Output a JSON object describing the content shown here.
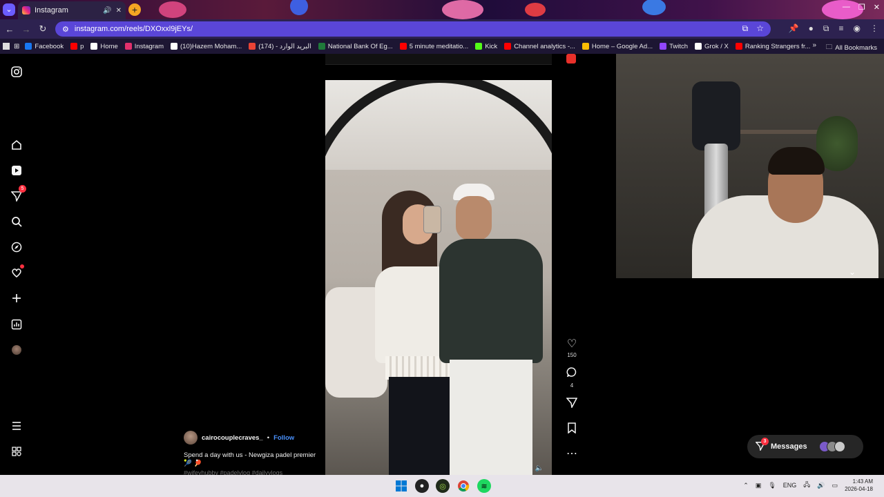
{
  "browser": {
    "tab_title": "Instagram",
    "url": "instagram.com/reels/DXOxxl9jEYs/",
    "bookmarks": [
      {
        "label": "Facebook",
        "color": "#1877f2"
      },
      {
        "label": "p",
        "color": "#ff0000"
      },
      {
        "label": "Home",
        "color": "#ffffff"
      },
      {
        "label": "Instagram",
        "color": "#e1306c"
      },
      {
        "label": "(10)Hazem Moham...",
        "color": "#ffffff"
      },
      {
        "label": "(174) - البريد الوارد",
        "color": "#ea4335"
      },
      {
        "label": "National Bank Of Eg...",
        "color": "#1f7a3a"
      },
      {
        "label": "5 minute meditatio...",
        "color": "#ff0000"
      },
      {
        "label": "Kick",
        "color": "#53fc18"
      },
      {
        "label": "Channel analytics -...",
        "color": "#ff0000"
      },
      {
        "label": "Home – Google Ad...",
        "color": "#fbbc04"
      },
      {
        "label": "Twitch",
        "color": "#9146ff"
      },
      {
        "label": "Grok / X",
        "color": "#ffffff"
      },
      {
        "label": "Ranking Strangers fr...",
        "color": "#ff0000"
      }
    ],
    "all_bookmarks": "All Bookmarks"
  },
  "sidebar": {
    "notifications_badge": "5"
  },
  "reel": {
    "likes": "150",
    "comments": "4",
    "username": "cairocouplecraves_",
    "separator": "•",
    "follow": "Follow",
    "caption_line": "Spend a day with us - Newgiza padel premier 🎾 🏓",
    "hashtags": "#wifeyhubby #padelvlog #dailyvlogs"
  },
  "messages": {
    "label": "Messages",
    "badge": "3"
  },
  "taskbar": {
    "lang": "ENG",
    "time": "1:43 AM",
    "date": "2026-04-18"
  }
}
